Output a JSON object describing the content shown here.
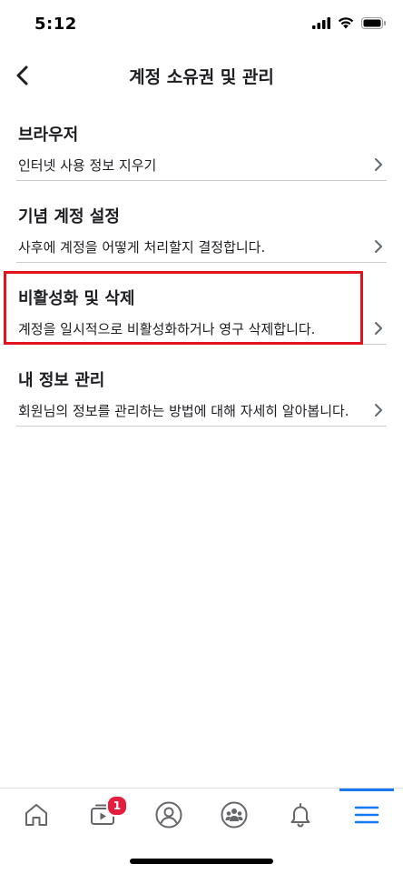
{
  "status_bar": {
    "time": "5:12",
    "icons": [
      "cellular-signal-icon",
      "wifi-icon",
      "battery-icon"
    ]
  },
  "nav": {
    "title": "계정 소유권 및 관리",
    "back_icon": "chevron-left-icon"
  },
  "sections": [
    {
      "title": "브라우저",
      "row_text": "인터넷 사용 정보 지우기"
    },
    {
      "title": "기념 계정 설정",
      "row_text": "사후에 계정을 어떻게 처리할지 결정합니다."
    },
    {
      "title": "비활성화 및 삭제",
      "row_text": "계정을 일시적으로 비활성화하거나 영구 삭제합니다."
    },
    {
      "title": "내 정보 관리",
      "row_text": "회원님의 정보를 관리하는 방법에 대해 자세히 알아봅니다."
    }
  ],
  "highlight_color": "#e0121d",
  "tab_bar": {
    "tabs": [
      {
        "icon": "home-icon"
      },
      {
        "icon": "watch-video-icon",
        "badge": "1"
      },
      {
        "icon": "profile-icon"
      },
      {
        "icon": "groups-icon"
      },
      {
        "icon": "bell-icon"
      },
      {
        "icon": "menu-icon",
        "active": true
      }
    ],
    "accent_color": "#1877f2",
    "badge_color": "#e41e3f"
  }
}
